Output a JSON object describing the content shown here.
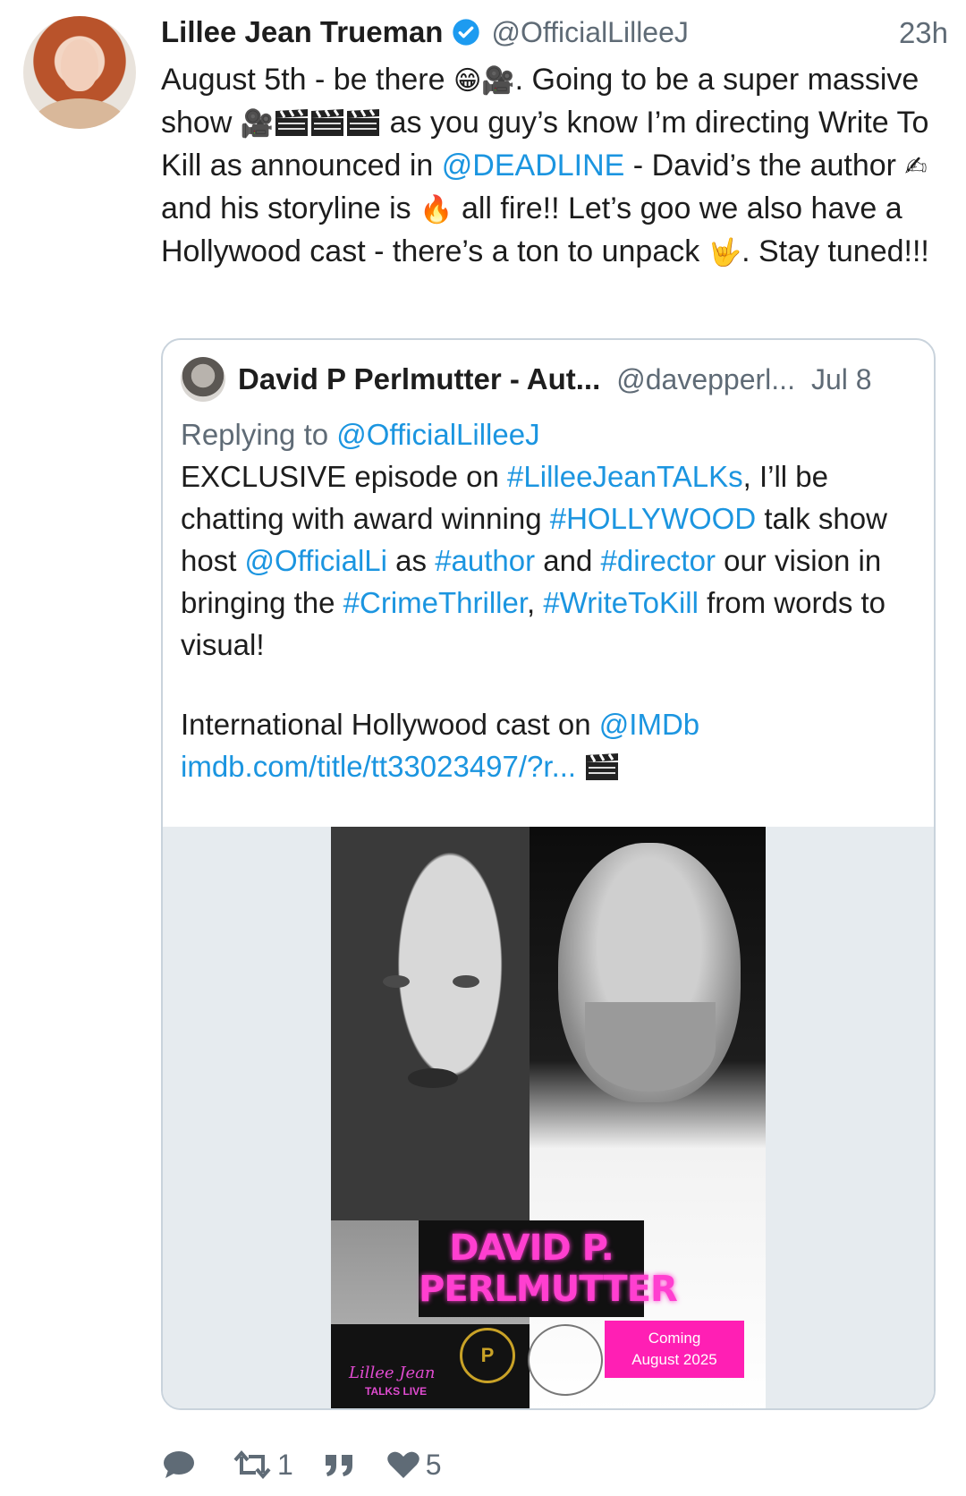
{
  "tweet": {
    "author_name": "Lillee Jean Trueman",
    "handle": "@OfficialLilleeJ",
    "time": "23h",
    "text": {
      "s1": "August 5th - be there ",
      "s2": ". Going to be a super massive show ",
      "s3": " as you guy’s know I’m directing Write To Kill as announced in ",
      "mention_deadline": "@DEADLINE",
      "s4": " - David’s the author ",
      "s5": " and his storyline is ",
      "s6": " all fire!! Let’s goo we also have a Hollywood cast - there’s a ton to unpack ",
      "s7": ". Stay tuned!!!"
    },
    "emoji": {
      "grin": "😁",
      "camera": "🎥",
      "writing_hand": "✍",
      "fire": "🔥",
      "rock_hand": "🤟"
    }
  },
  "quote": {
    "author_name": "David P Perlmutter - Aut...",
    "handle": "@davepperl...",
    "date": "Jul 8",
    "reply_prefix": "Replying to ",
    "reply_to": "@OfficialLilleeJ",
    "t1": "EXCLUSIVE episode on ",
    "tag_lilleejeantalks": "#LilleeJeanTALKs",
    "t2": ", I’ll be chatting with award winning ",
    "tag_hollywood": "#HOLLYWOOD",
    "t3": " talk show host ",
    "mention_officialli": "@OfficialLi",
    "t4": " as ",
    "tag_author": "#author",
    "t5": " and ",
    "tag_director": "#director",
    "t6": " our vision in bringing the ",
    "tag_crimethriller": "#CrimeThriller",
    "t7": ", ",
    "tag_writetokill": "#WriteToKill",
    "t8": " from words to visual!",
    "t9": "International Hollywood cast on ",
    "mention_imdb": "@IMDb",
    "link": "imdb.com/title/tt33023497/?r..."
  },
  "poster": {
    "name_line1": "DAVID P.",
    "name_line2": "PERLMUTTER",
    "brand_title": "Lillee Jean",
    "brand_sub": "TALKS LIVE",
    "coming_line1": "Coming",
    "coming_line2": "August 2025"
  },
  "actions": {
    "reply_count": "",
    "retweet_count": "1",
    "like_count": "5"
  },
  "colors": {
    "link": "#1b95e0",
    "secondary_text": "#5f6b76",
    "verified": "#1d9bf0"
  }
}
